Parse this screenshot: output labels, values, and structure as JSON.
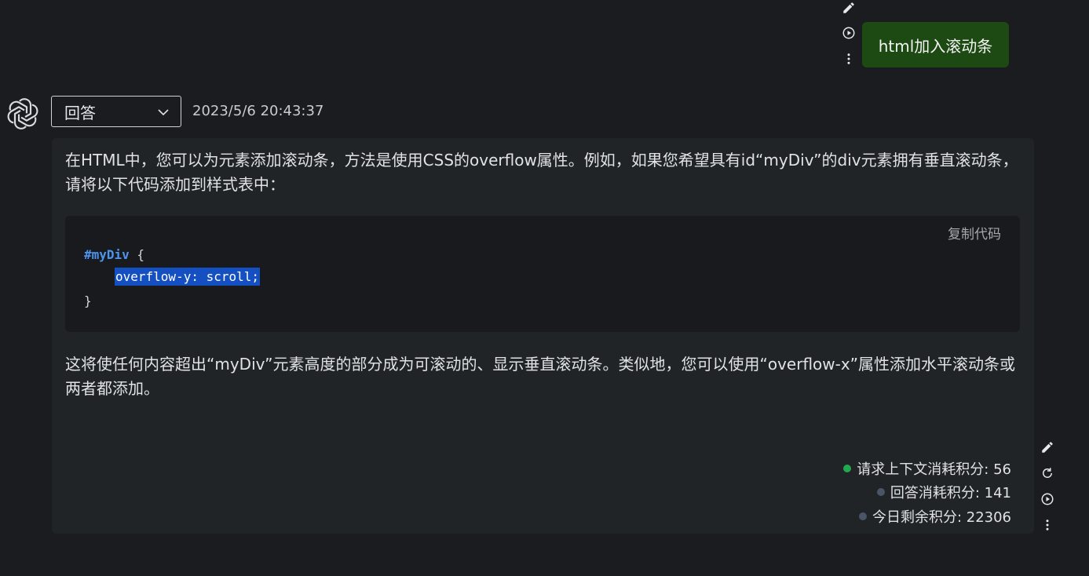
{
  "user_message": {
    "text": "html加入滚动条"
  },
  "answer_header": {
    "mode_select": {
      "value": "回答"
    },
    "timestamp": "2023/5/6 20:43:37"
  },
  "answer": {
    "paragraph1": "在HTML中，您可以为元素添加滚动条，方法是使用CSS的overflow属性。例如，如果您希望具有id“myDiv”的div元素拥有垂直滚动条，请将以下代码添加到样式表中：",
    "code": {
      "copy_label": "复制代码",
      "line1_selector": "#myDiv",
      "line1_brace": " {",
      "line2": "overflow-y: scroll;",
      "line3": "}"
    },
    "paragraph2": "这将使任何内容超出“myDiv”元素高度的部分成为可滚动的、显示垂直滚动条。类似地，您可以使用“overflow-x”属性添加水平滚动条或两者都添加。"
  },
  "stats": [
    {
      "label": "请求上下文消耗积分: 56",
      "dot_color": "#22a94f"
    },
    {
      "label": "回答消耗积分: 141",
      "dot_color": "#4a5568"
    },
    {
      "label": "今日剩余积分: 22306",
      "dot_color": "#4a5568"
    }
  ],
  "icons": {
    "user_actions": [
      "pencil-icon",
      "play-circle-icon",
      "more-vertical-icon"
    ],
    "answer_actions": [
      "pencil-icon",
      "refresh-icon",
      "play-circle-icon",
      "more-vertical-icon"
    ],
    "avatar": "openai-logo-icon",
    "select_arrow": "chevron-down-icon"
  },
  "colors": {
    "background": "#1a1c1f",
    "user_bubble": "#1c4a12",
    "answer_card": "#202427",
    "code_background": "#181a1d",
    "selection": "#1550c2",
    "code_keyword": "#4d95ee"
  }
}
